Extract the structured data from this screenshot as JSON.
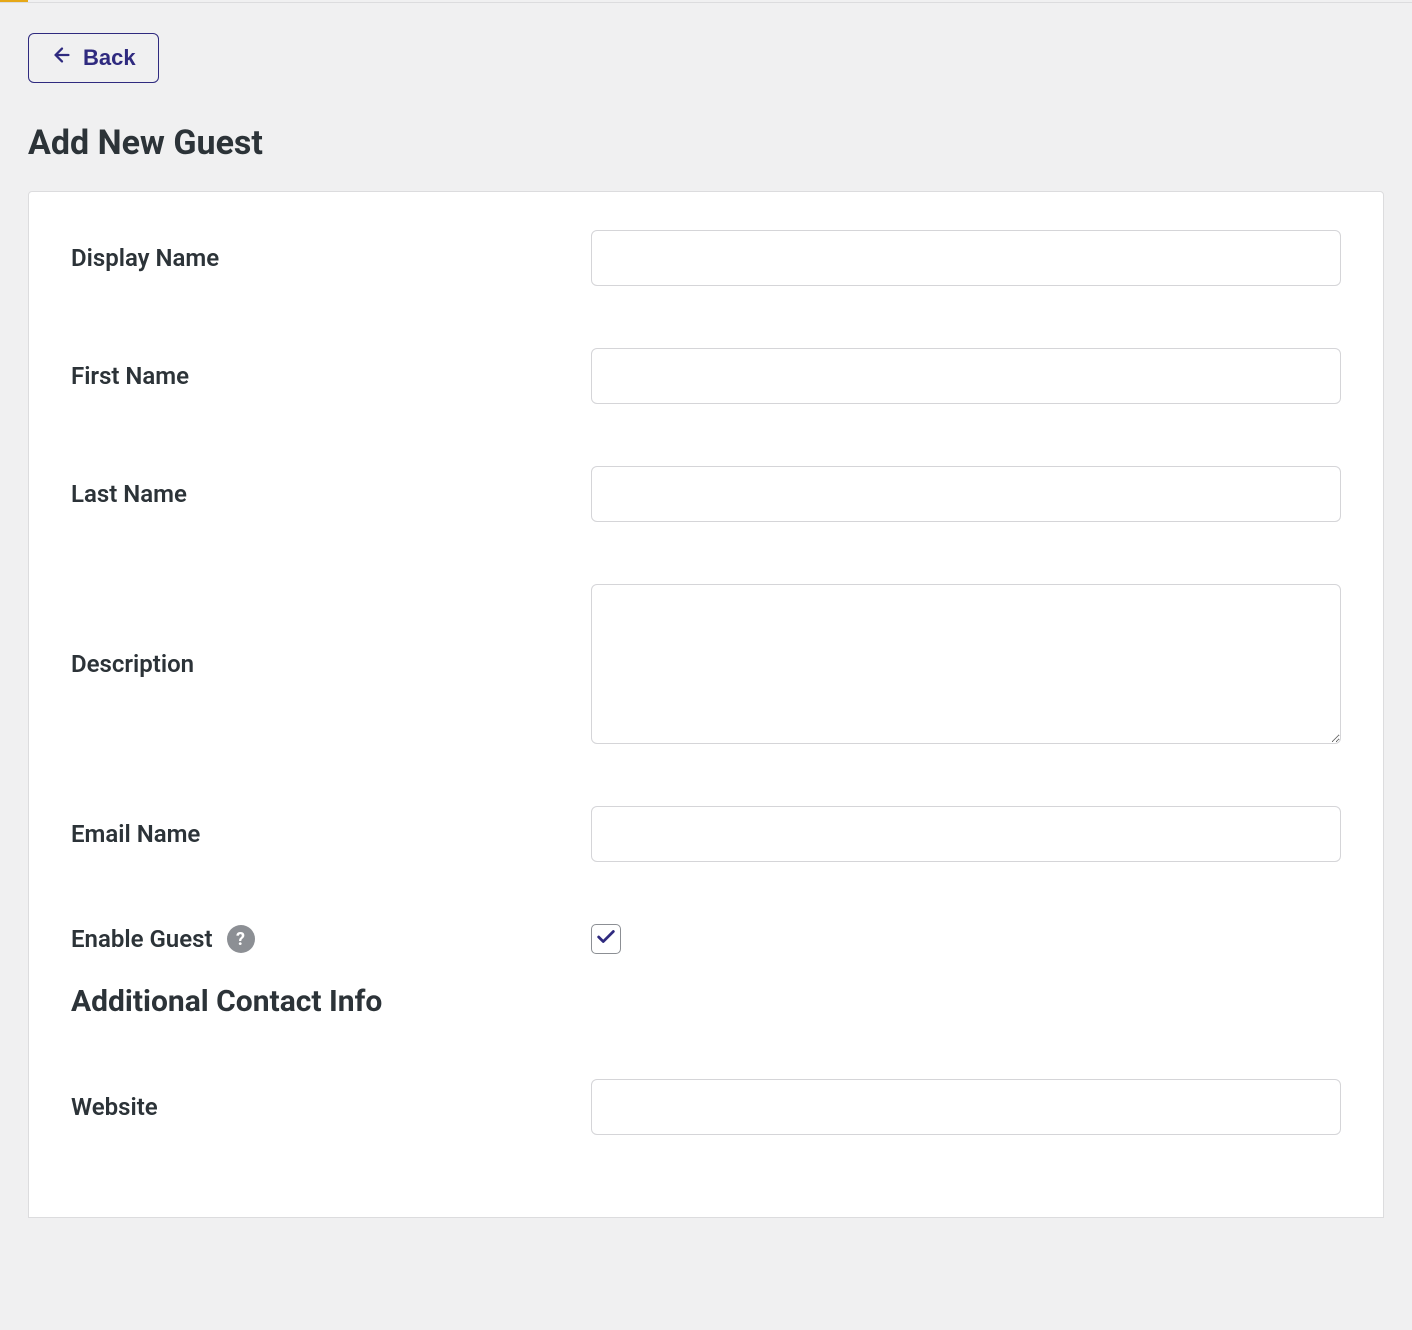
{
  "header": {
    "back_label": "Back",
    "page_title": "Add New Guest"
  },
  "form": {
    "fields": {
      "display_name": {
        "label": "Display Name",
        "value": ""
      },
      "first_name": {
        "label": "First Name",
        "value": ""
      },
      "last_name": {
        "label": "Last Name",
        "value": ""
      },
      "description": {
        "label": "Description",
        "value": ""
      },
      "email_name": {
        "label": "Email Name",
        "value": ""
      },
      "enable_guest": {
        "label": "Enable Guest",
        "checked": true
      },
      "website": {
        "label": "Website",
        "value": ""
      }
    },
    "section_title": "Additional Contact Info"
  },
  "colors": {
    "accent": "#2f2a7f",
    "page_bg": "#f0f0f1",
    "card_bg": "#ffffff",
    "border": "#d5d5d8"
  }
}
